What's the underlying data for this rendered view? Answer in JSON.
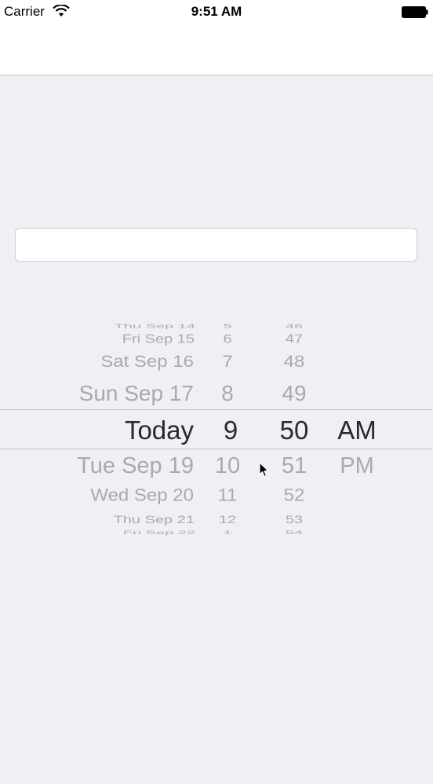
{
  "status_bar": {
    "carrier": "Carrier",
    "time": "9:51 AM",
    "wifi_icon": "wifi-icon",
    "battery_icon": "battery-icon"
  },
  "date_field": {
    "value": "",
    "placeholder": ""
  },
  "picker": {
    "rows": [
      {
        "date": "Thu Sep 14",
        "hour": "5",
        "minute": "46",
        "ampm": ""
      },
      {
        "date": "Fri Sep 15",
        "hour": "6",
        "minute": "47",
        "ampm": ""
      },
      {
        "date": "Sat Sep 16",
        "hour": "7",
        "minute": "48",
        "ampm": ""
      },
      {
        "date": "Sun Sep 17",
        "hour": "8",
        "minute": "49",
        "ampm": ""
      },
      {
        "date": "Today",
        "hour": "9",
        "minute": "50",
        "ampm": "AM"
      },
      {
        "date": "Tue Sep 19",
        "hour": "10",
        "minute": "51",
        "ampm": "PM"
      },
      {
        "date": "Wed Sep 20",
        "hour": "11",
        "minute": "52",
        "ampm": ""
      },
      {
        "date": "Thu Sep 21",
        "hour": "12",
        "minute": "53",
        "ampm": ""
      },
      {
        "date": "Fri Sep 22",
        "hour": "1",
        "minute": "54",
        "ampm": ""
      }
    ],
    "selected": {
      "date": "Today",
      "hour": "9",
      "minute": "50",
      "ampm": "AM"
    }
  },
  "colors": {
    "background": "#efeff4",
    "selected_text": "#2a2a2a",
    "faded_text": "#a9a9ae",
    "separator": "#c8c7cc"
  }
}
